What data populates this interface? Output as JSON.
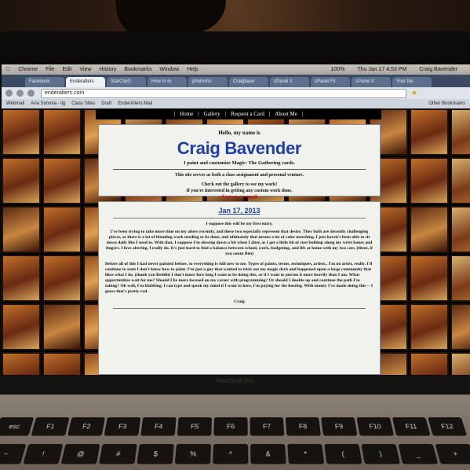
{
  "browser": {
    "menubar": [
      "Chrome",
      "File",
      "Edit",
      "View",
      "History",
      "Bookmarks",
      "Window",
      "Help"
    ],
    "status": {
      "battery": "100%",
      "clock": "Thu Jan 17 4:53 PM",
      "user": "Craig Bavender"
    },
    "tabs": [
      "Facebook",
      "Enderalters",
      "StarCityG",
      "How to m",
      "photosho",
      "Craigbave",
      "cPanel X",
      "cPanel Fil",
      "cPanel X",
      "Your Ne"
    ],
    "url": "enderalters.com",
    "bookmarks": [
      "Webmail",
      "Ana Somnia - lig",
      "Class Sites",
      "Draft",
      "EnderAlters Mail"
    ],
    "other_bookmarks": "Other Bookmarks"
  },
  "site": {
    "nav": [
      "|",
      "Home",
      "|",
      "Gallery",
      "|",
      "Request a Card",
      "|",
      "About Me",
      "|"
    ],
    "hero": {
      "hello": "Hello, my name is",
      "name": "Craig Bavender",
      "tagline": "I paint and customize Magic: The Gathering cards.",
      "purpose": "This site serves as both a class assignment and personal venture.",
      "line1": "Check out the gallery to see my work!",
      "line2": "If you're interested in getting any custom work done,",
      "email_link": "shoot me an email."
    },
    "post": {
      "date": "Jan 17, 2013",
      "para1": "I suppose this will be my first entry.",
      "para2": "I've been trying to take more time on my alters recently, and these two especially represent that desire. They both are decently challenging pieces, as there is a lot of blending work needing to be done, and ultimately that means a lot of color matching. I just haven't been able to sit down daily like I used to. With that, I suppose I'm slowing down a bit when I alter, as I get a little bit of rust buildup along my wrist bones and fingers. I love altering, I really do. It's just hard to find a balance between school, work, budgeting, and life at home with my two cats. (three, if you count Ben)",
      "para3": "Before all of this I had never painted before, so everything is still new to me. Types of paints, terms, techniques, artists.. I'm no artist, really. I'll continue to state I don't know how to paint. I'm just a guy that wanted to trick out my magic deck and happened upon a large community that likes what I do. (thank you Reddit) I don't know how long I want to be doing this, or if I want to pursue it more heavily than I am. What opportunities wait for me? Should I be more focused on my career with programming? Or should I double up and continue the path I'm taking? Oh well, I'm blabbing. I can type and speak my mind if I want to here, I'm paying for the hosting. With money I've made doing this -- I guess that's pretty rad.",
      "signature": "Craig"
    }
  },
  "laptop": {
    "brand": "MacBook Pro",
    "keys": [
      "esc",
      "F1",
      "F2",
      "F3",
      "F4",
      "F5",
      "F6",
      "F7",
      "F8",
      "F9",
      "F10",
      "F11",
      "F12",
      "~",
      "!",
      "@",
      "#",
      "$",
      "%",
      "^",
      "&",
      "*",
      "(",
      ")",
      "_",
      "+"
    ]
  }
}
